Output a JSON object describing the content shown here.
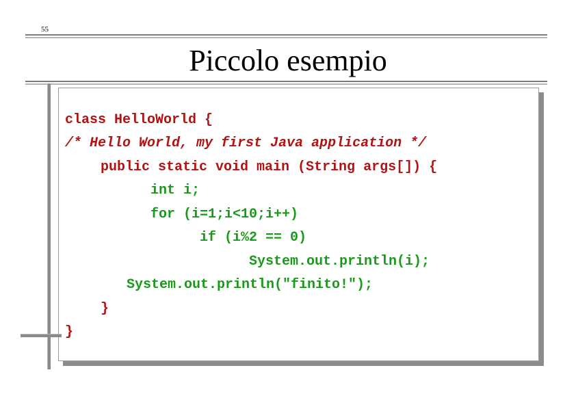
{
  "page_number": "55",
  "title": "Piccolo esempio",
  "code_lines": [
    "class HelloWorld {",
    "/* Hello World, my first Java application */",
    "public static void main (String args[]) {",
    "int i;",
    "for (i=1;i<10;i++)",
    "if (i%2 == 0)",
    "System.out.println(i);",
    "System.out.println(\"finito!\");",
    "}",
    "}"
  ],
  "colors": {
    "class_keyword": "#b31212",
    "comment": "#b31212",
    "method": "#b31212",
    "body": "#1a9a1a"
  }
}
